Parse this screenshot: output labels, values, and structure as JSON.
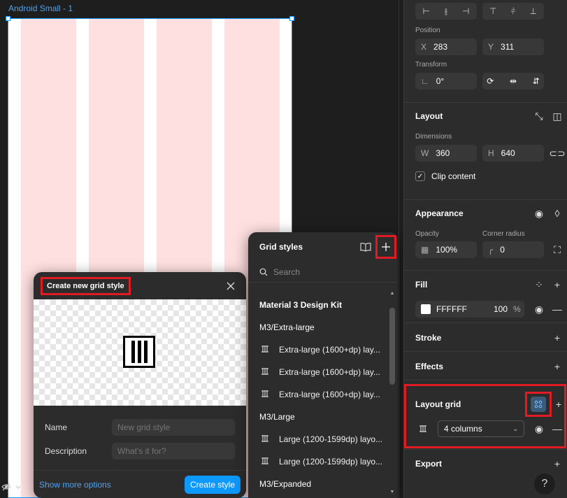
{
  "canvas": {
    "frame_label": "Android Small - 1"
  },
  "dialog": {
    "title": "Create new grid style",
    "name_label": "Name",
    "name_placeholder": "New grid style",
    "description_label": "Description",
    "description_placeholder": "What's it for?",
    "show_more": "Show more options",
    "create_button": "Create style"
  },
  "grid_styles": {
    "title": "Grid styles",
    "search_placeholder": "Search",
    "kit_name": "Material 3 Design Kit",
    "groups": [
      {
        "name": "M3/Extra-large",
        "items": [
          "Extra-large (1600+dp) lay...",
          "Extra-large (1600+dp) lay...",
          "Extra-large (1600+dp) lay..."
        ]
      },
      {
        "name": "M3/Large",
        "items": [
          "Large (1200-1599dp) layo...",
          "Large (1200-1599dp) layo..."
        ]
      },
      {
        "name": "M3/Expanded",
        "items": []
      }
    ]
  },
  "properties": {
    "position_label": "Position",
    "x_label": "X",
    "x_value": "283",
    "y_label": "Y",
    "y_value": "311",
    "transform_label": "Transform",
    "rotation_value": "0°",
    "layout_title": "Layout",
    "dimensions_label": "Dimensions",
    "w_label": "W",
    "w_value": "360",
    "h_label": "H",
    "h_value": "640",
    "clip_content": "Clip content",
    "appearance_title": "Appearance",
    "opacity_label": "Opacity",
    "opacity_value": "100%",
    "corner_radius_label": "Corner radius",
    "corner_radius_value": "0",
    "fill_title": "Fill",
    "fill_hex": "FFFFFF",
    "fill_opacity": "100",
    "fill_opacity_unit": "%",
    "stroke_title": "Stroke",
    "effects_title": "Effects",
    "layout_grid_title": "Layout grid",
    "layout_grid_value": "4 columns",
    "export_title": "Export",
    "help": "?"
  },
  "colors": {
    "accent": "#0d99ff",
    "highlight": "#e01b24",
    "grid_column": "#ffe0e0",
    "fill": "#FFFFFF"
  }
}
